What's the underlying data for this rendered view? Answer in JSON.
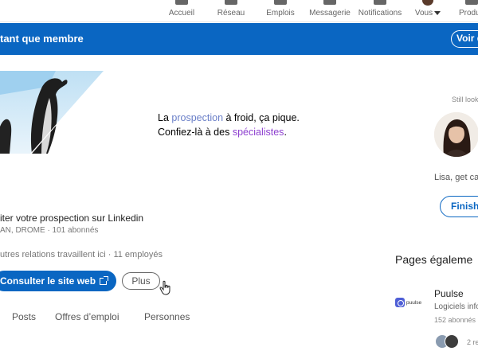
{
  "nav": {
    "items": [
      {
        "label": "Accueil"
      },
      {
        "label": "Réseau"
      },
      {
        "label": "Emplois"
      },
      {
        "label": "Messagerie"
      },
      {
        "label": "Notifications"
      },
      {
        "label": "Vous"
      },
      {
        "label": "Produ"
      }
    ]
  },
  "banner": {
    "text": "tant que membre",
    "button": "Voir d"
  },
  "cover": {
    "line1_a": "La ",
    "line1_hl": "prospection",
    "line1_b": " à froid, ça pique.",
    "line2_a": "Confiez-là à des ",
    "line2_hl": "spécialistes",
    "line2_b": "."
  },
  "company": {
    "tagline": "iter votre prospection sur Linkedin",
    "location": "AN, DROME · 101 abonnés",
    "relations": "utres relations travaillent ici · 11 employés"
  },
  "actions": {
    "website": "Consulter le site web",
    "more": "Plus"
  },
  "tabs": [
    {
      "label": "Posts"
    },
    {
      "label": "Offres d’emploi"
    },
    {
      "label": "Personnes"
    }
  ],
  "right": {
    "still_looking": "Still look",
    "lisa_text": "Lisa, get ca",
    "finish_button": "Finish",
    "pages_heading": "Pages égaleme",
    "puulse": {
      "logo_word": "puulse",
      "name": "Puulse",
      "subtitle": "Logiciels info",
      "followers": "152 abonnés",
      "mutual": "2 re"
    }
  },
  "colors": {
    "brand_blue": "#0a66c2",
    "highlight_blue": "#6a7fc8",
    "highlight_purple": "#8d3fcf"
  }
}
